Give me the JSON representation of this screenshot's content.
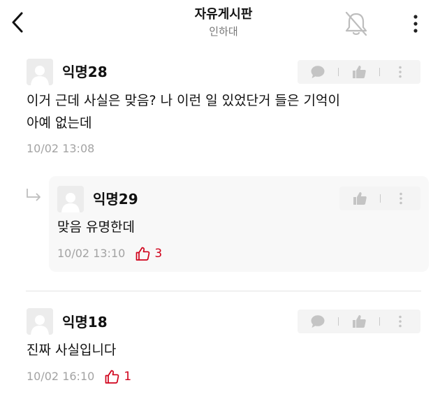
{
  "header": {
    "title": "자유게시판",
    "subtitle": "인하대"
  },
  "comments": [
    {
      "nickname": "익명28",
      "lines": [
        "이거 근데 사실은 맞음? 나 이런 일 있었단거 들은 기억이",
        "아예 없는데"
      ],
      "time": "10/02 13:08",
      "likes": ""
    },
    {
      "nickname": "익명29",
      "lines": [
        "맞음 유명한데"
      ],
      "time": "10/02 13:10",
      "likes": "3"
    },
    {
      "nickname": "익명18",
      "lines": [
        "진짜 사실입니다"
      ],
      "time": "10/02 16:10",
      "likes": "1"
    }
  ],
  "colors": {
    "like_accent": "#d0021b",
    "meta_gray": "#a3a3a3"
  }
}
